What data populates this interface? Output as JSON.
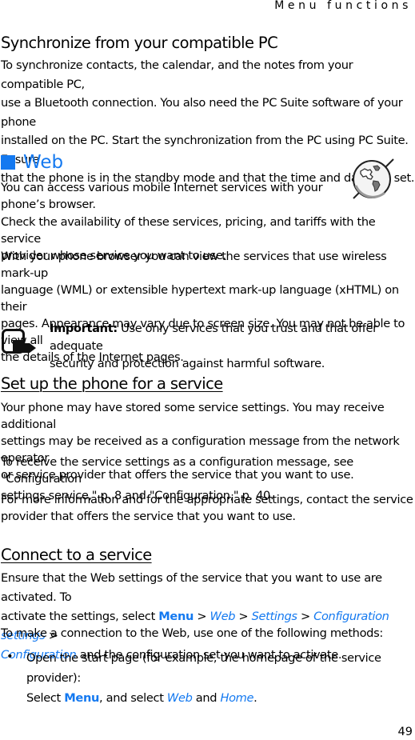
{
  "running_head": "Menu functions",
  "sync_section": {
    "title": "Synchronize from your compatible PC",
    "lines": [
      "To synchronize contacts, the calendar, and the notes from your compatible PC,",
      "use a Bluetooth connection. You also need the PC Suite software of your phone",
      "installed on the PC. Start the synchronization from the PC using PC Suite. Ensure",
      "that the phone is in the standby mode and that the time and date are set."
    ]
  },
  "web_section": {
    "title": "Web",
    "accent_color": "#1479f0",
    "icon": "globe-icon",
    "intro_lines": [
      "You can access various mobile Internet services with your",
      "phone’s browser."
    ],
    "check_lines": [
      "Check the availability of these services, pricing, and tariffs with the service",
      "provider whose service you want to use."
    ],
    "browser_lines": [
      "With your phone browser you can view the services that use wireless mark-up",
      "language (WML) or extensible hypertext mark-up language (xHTML) on their",
      "pages. Appearance may vary due to screen size. You may not be able to view all",
      "the details of the Internet pages."
    ],
    "note": {
      "icon": "note-hand-icon",
      "label": "Important:",
      "line1": " Use only services that you trust and that offer adequate",
      "line2": "security and protection against harmful software."
    }
  },
  "setup_section": {
    "title": "Set up the phone for a service",
    "para1": [
      "Your phone may have stored some service settings. You may receive additional",
      "settings may be received as a configuration message from the network operator",
      "or service provider that offers the service that you want to use."
    ],
    "para2": [
      "To receive the service settings as a configuration message, see \"Configuration",
      "settings service,\" p. 8 and \"Configuration,\" p. 40."
    ],
    "para3": [
      "For more information and for the appropriate settings, contact the service",
      "provider that offers the service that you want to use."
    ]
  },
  "connect_section": {
    "title": "Connect to a service",
    "line1": "Ensure that the Web settings of the service that you want to use are activated. To",
    "line2_prefix": "activate the settings, select ",
    "menu": "Menu",
    "sep": " > ",
    "web": "Web",
    "settings": "Settings",
    "config_settings": "Configuration settings",
    "configuration": "Configuration",
    "line3_suffix": " and the configuration set you want to activate.",
    "methods_intro": "To make a connection to the Web, use one of the following methods:",
    "bullet_char": "•",
    "bullet_line1": "Open the start page (for example, the homepage of the service provider):",
    "bullet_select": "Select ",
    "bullet_mid": ", and select ",
    "bullet_and": " and ",
    "home": "Home",
    "period": "."
  },
  "page_number": "49"
}
